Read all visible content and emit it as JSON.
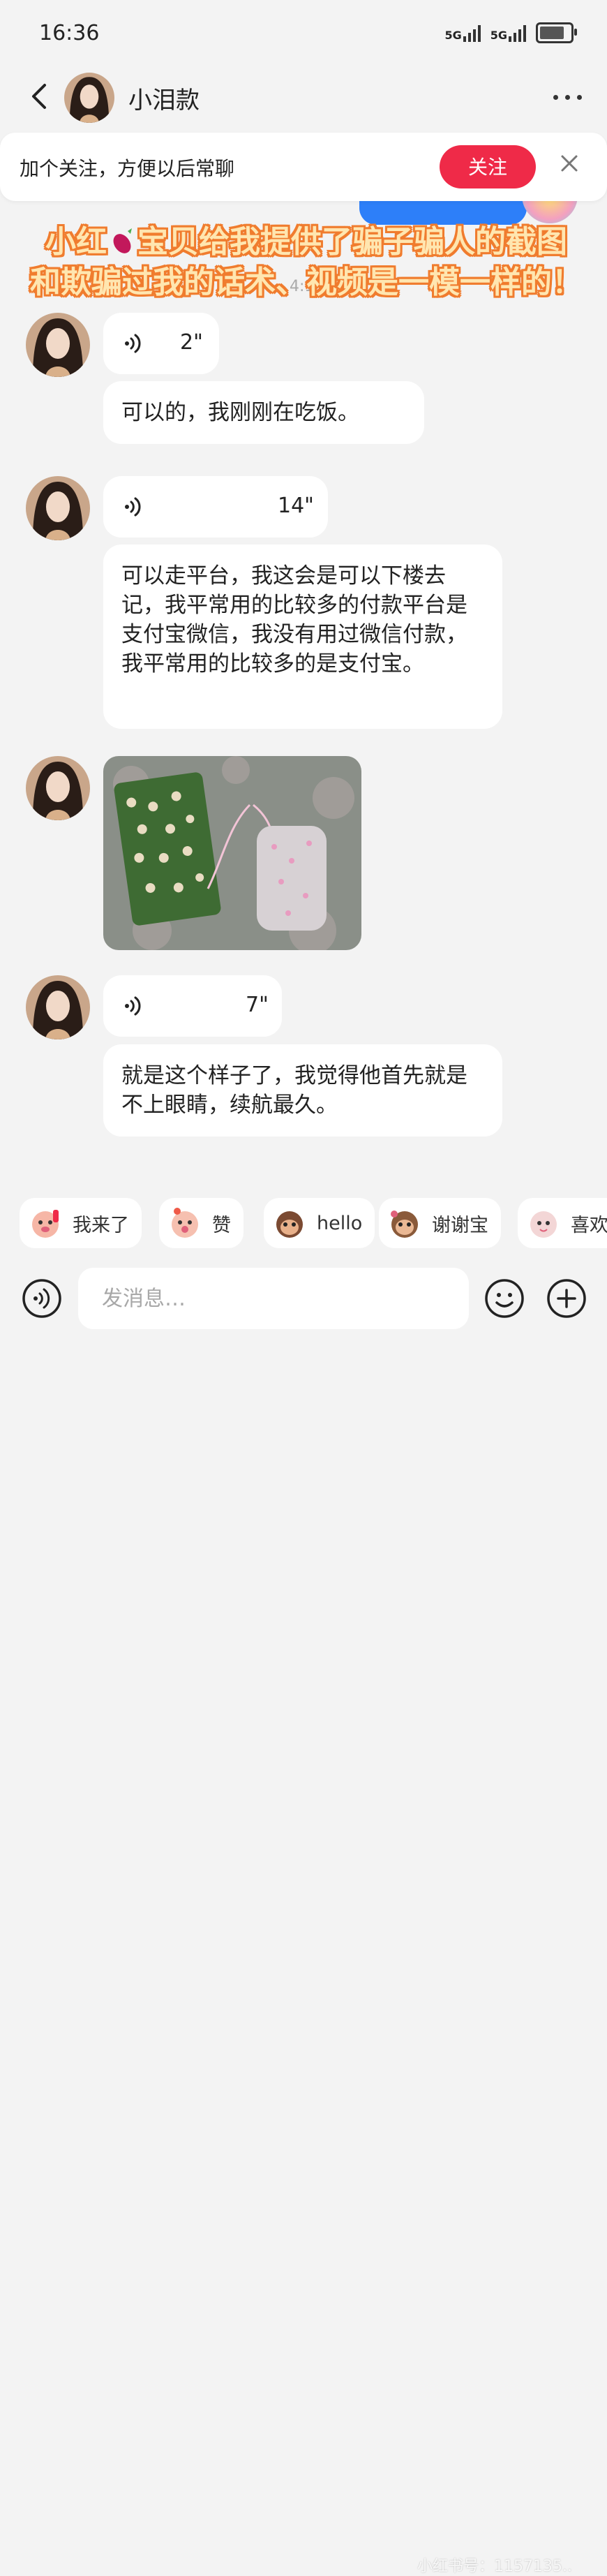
{
  "status_bar": {
    "time": "16:36",
    "signal_1": "5G",
    "signal_2": "5G"
  },
  "header": {
    "title": "小泪款"
  },
  "follow_banner": {
    "text": "加个关注，方便以后常聊",
    "button_label": "关注"
  },
  "overlay_caption": {
    "line1_a": "小红",
    "line1_b": "宝贝给我提供了骗子骗人的截图",
    "line2": "和欺骗过我的话术、视频是一模一样的！"
  },
  "timestamp": "4:1",
  "messages": [
    {
      "type": "voice",
      "duration": "2\""
    },
    {
      "type": "text",
      "text": "可以的，我刚刚在吃饭。"
    },
    {
      "type": "voice",
      "duration": "14\""
    },
    {
      "type": "text",
      "text": "可以走平台，我这会是可以下楼去记，我平常用的比较多的付款平台是支付宝微信，我没有用过微信付款，我平常用的比较多的是支付宝。"
    },
    {
      "type": "image",
      "description": "photo"
    },
    {
      "type": "voice",
      "duration": "7\""
    },
    {
      "type": "text",
      "text": "就是这个样子了，我觉得他首先就是不上眼睛，续航最久。"
    }
  ],
  "quick_replies": [
    "我来了",
    "赞",
    "hello",
    "谢谢宝",
    "喜欢"
  ],
  "input": {
    "placeholder": "发消息…"
  },
  "watermark": "小红书号：1157135..",
  "colors": {
    "accent": "#ef2a48",
    "bubble": "#ffffff",
    "background": "#f3f3f3",
    "caption_fill": "#ffe6b0",
    "caption_stroke": "#f07c2e"
  }
}
